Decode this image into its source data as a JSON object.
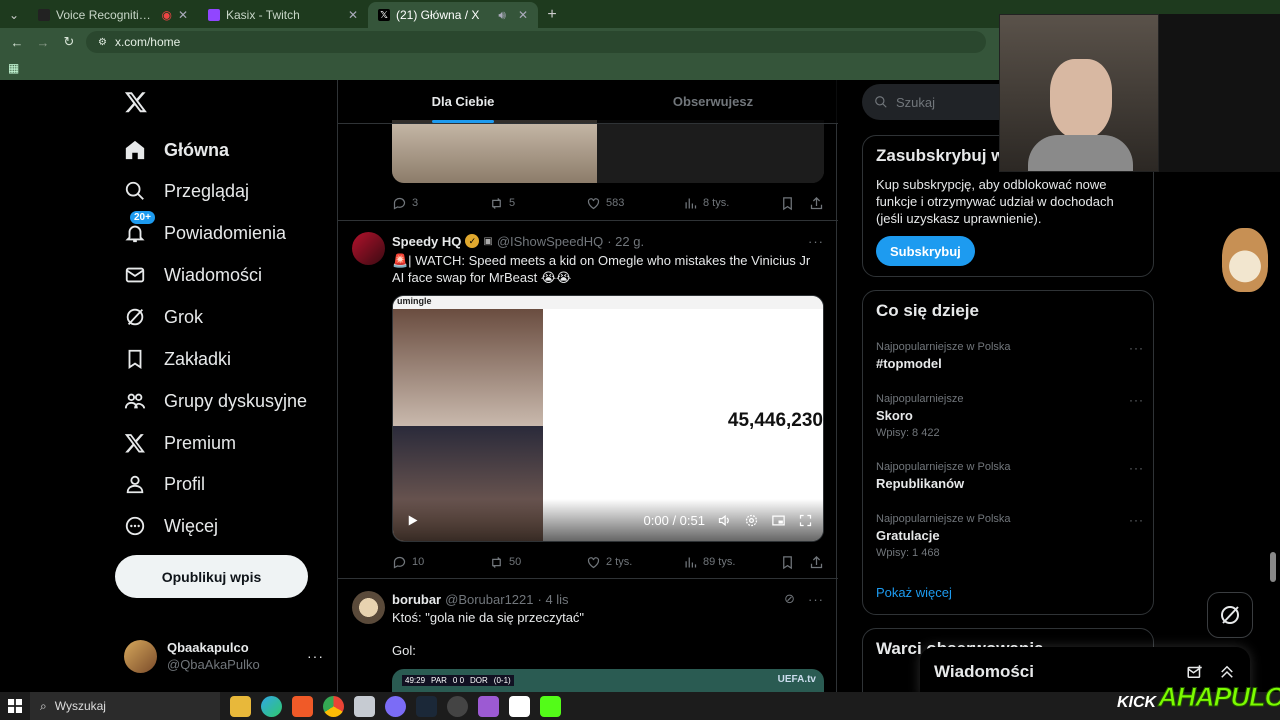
{
  "browser": {
    "tabs": [
      {
        "title": "Voice Recognition | inStrea",
        "color": "#111111"
      },
      {
        "title": "Kasix - Twitch",
        "color": "#9146ff"
      },
      {
        "title": "(21) Główna / X",
        "color": "#000000"
      }
    ],
    "url": "x.com/home"
  },
  "nav": {
    "items": [
      {
        "label": "Główna",
        "icon": "home-icon"
      },
      {
        "label": "Przeglądaj",
        "icon": "search-icon"
      },
      {
        "label": "Powiadomienia",
        "icon": "bell-icon",
        "badge": "20+"
      },
      {
        "label": "Wiadomości",
        "icon": "mail-icon"
      },
      {
        "label": "Grok",
        "icon": "grok-icon"
      },
      {
        "label": "Zakładki",
        "icon": "bookmark-icon"
      },
      {
        "label": "Grupy dyskusyjne",
        "icon": "communities-icon"
      },
      {
        "label": "Premium",
        "icon": "x-icon"
      },
      {
        "label": "Profil",
        "icon": "person-icon"
      },
      {
        "label": "Więcej",
        "icon": "more-circle-icon"
      }
    ],
    "post_button": "Opublikuj wpis",
    "account": {
      "name": "Qbaakapulco",
      "handle": "@QbaAkaPulko"
    }
  },
  "feed": {
    "tabs": [
      "Dla Ciebie",
      "Obserwujesz"
    ],
    "first_post_stats": {
      "replies": "3",
      "reposts": "5",
      "likes": "583",
      "views": "8 tys."
    },
    "tweet": {
      "name": "Speedy HQ",
      "handle": "@IShowSpeedHQ",
      "time": "· 22 g.",
      "text": "🚨| WATCH: Speed meets a kid on Omegle who mistakes the Vinicius Jr AI face swap for MrBeast 😭😭",
      "video_brand": "umingle",
      "video_counter": "45,446,230",
      "video_time": "0:00 / 0:51",
      "stats": {
        "replies": "10",
        "reposts": "50",
        "likes": "2 tys.",
        "views": "89 tys."
      }
    },
    "tweet2": {
      "name": "borubar",
      "handle": "@Borubar1221",
      "time": "· 4 lis",
      "text": "Ktoś: \"gola nie da się przeczytać\"",
      "text2": "Gol:",
      "score_time": "49:29",
      "team1": "PAR",
      "score": "0  0",
      "team2": "DOR",
      "agg": "(0-1)",
      "brand": "UEFA.tv"
    }
  },
  "sidebar": {
    "search_placeholder": "Szukaj",
    "premium": {
      "title": "Zasubskrybuj w",
      "text": "Kup subskrypcję, aby odblokować nowe funkcje i otrzymywać udział w dochodach (jeśli uzyskasz uprawnienie).",
      "button": "Subskrybuj"
    },
    "trends": {
      "title": "Co się dzieje",
      "items": [
        {
          "context": "Najpopularniejsze w Polska",
          "topic": "#topmodel",
          "count": ""
        },
        {
          "context": "Najpopularniejsze",
          "topic": "Skoro",
          "count": "Wpisy: 8 422"
        },
        {
          "context": "Najpopularniejsze w Polska",
          "topic": "Republikanów",
          "count": ""
        },
        {
          "context": "Najpopularniejsze w Polska",
          "topic": "Gratulacje",
          "count": "Wpisy: 1 468"
        }
      ],
      "show_more": "Pokaż więcej"
    },
    "follow_title": "Warci obserwowania"
  },
  "messages_dock": {
    "title": "Wiadomości"
  },
  "overlay": {
    "kick": "KICK",
    "brand": "AHAPULCO"
  },
  "taskbar": {
    "search": "Wyszukaj"
  },
  "colors": {
    "accent": "#1d9bf0",
    "browser_frame": "#35553a"
  }
}
